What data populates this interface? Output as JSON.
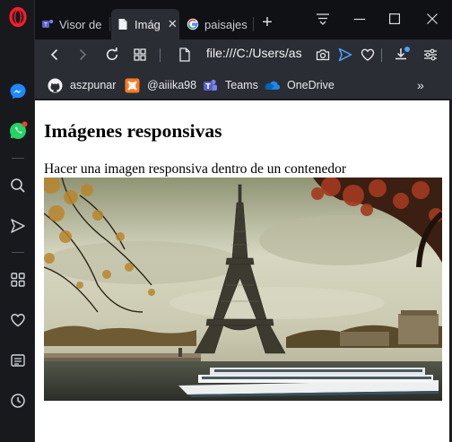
{
  "browser": {
    "tabs": [
      {
        "label": "Visor de",
        "icon": "teams-icon",
        "active": false
      },
      {
        "label": "Imág",
        "icon": "document-icon",
        "active": true
      },
      {
        "label": "paisajes",
        "icon": "google-icon",
        "active": false
      }
    ],
    "address": "file:///C:/Users/as",
    "accent": "#4aa3ff"
  },
  "bookmarks": [
    {
      "label": "aszpunar",
      "icon": "github-icon"
    },
    {
      "label": "@aiiika98",
      "icon": "xampp-icon"
    },
    {
      "label": "Teams",
      "icon": "teams-icon"
    },
    {
      "label": "OneDrive",
      "icon": "onedrive-icon"
    }
  ],
  "page": {
    "heading": "Imágenes responsivas",
    "paragraph": "Hacer una imagen responsiva dentro de un contenedor",
    "image_subject": "eiffel-tower-paris-photo"
  }
}
